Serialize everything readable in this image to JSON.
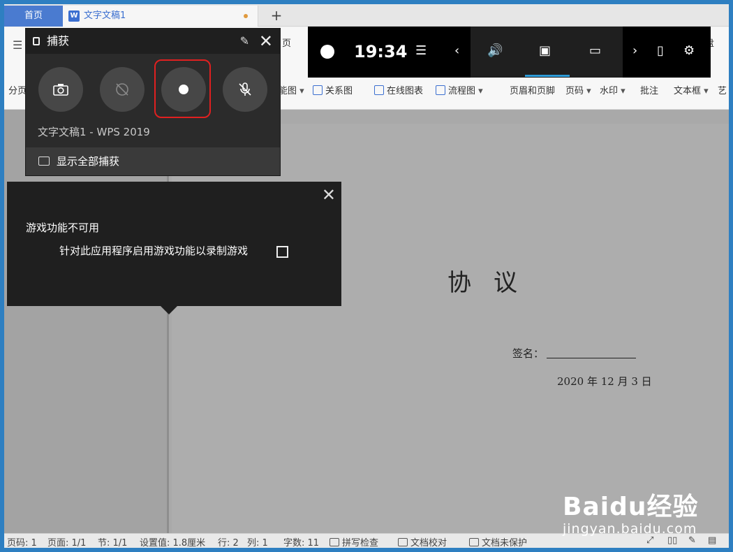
{
  "tabs": {
    "home": "首页",
    "doc": "文字文稿1",
    "add": "+"
  },
  "ribbon": {
    "items": [
      {
        "label": "分页"
      },
      {
        "label": "能图"
      },
      {
        "label": "关系图"
      },
      {
        "label": "在线图表"
      },
      {
        "label": "流程图"
      },
      {
        "label": "页眉和页脚"
      },
      {
        "label": "页码"
      },
      {
        "label": "水印"
      },
      {
        "label": "批注"
      },
      {
        "label": "文本框"
      },
      {
        "label": "艺"
      }
    ],
    "partial_labels": [
      "页",
      "盘"
    ]
  },
  "capture": {
    "title": "捕获",
    "app_name": "文字文稿1 - WPS 2019",
    "show_all": "显示全部捕获",
    "buttons": [
      "screenshot-icon",
      "record-last-icon",
      "record-icon",
      "mic-off-icon"
    ]
  },
  "gamebar": {
    "time": "19:34",
    "icons": [
      "xbox-icon",
      "menu-icon",
      "chevron-left-icon",
      "volume-icon",
      "capture-icon",
      "performance-icon",
      "chevron-right-icon",
      "mouse-icon",
      "settings-icon"
    ]
  },
  "popup": {
    "title": "游戏功能不可用",
    "message": "针对此应用程序启用游戏功能以录制游戏"
  },
  "document": {
    "title": "协议",
    "sign_label": "签名：",
    "date": "2020 年 12 月 3 日"
  },
  "status": {
    "page_code": "页码: 1",
    "pages": "页面: 1/1",
    "section": "节: 1/1",
    "setting": "设置值: 1.8厘米",
    "row": "行: 2",
    "col": "列: 1",
    "words": "字数: 11",
    "spell": "拼写检查",
    "proof": "文档校对",
    "protect": "文档未保护"
  },
  "watermark": {
    "logo": "Baidu经验",
    "url": "jingyan.baidu.com"
  }
}
